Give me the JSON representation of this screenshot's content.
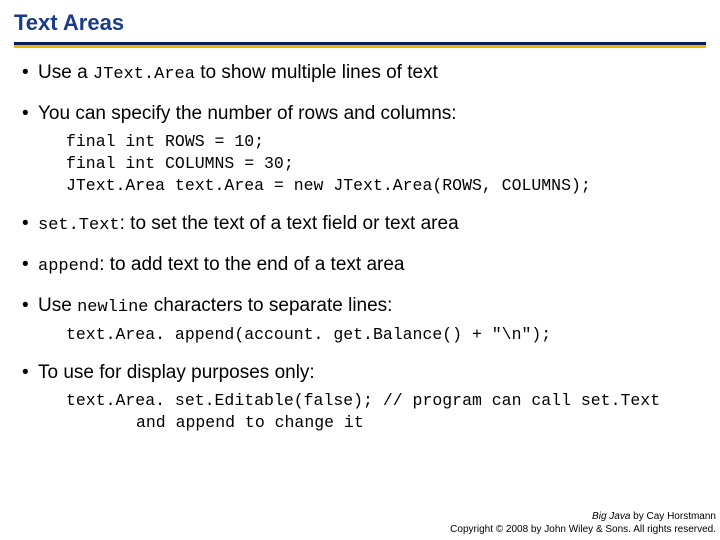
{
  "slide": {
    "title": "Text Areas",
    "bullets": {
      "b1": {
        "pre": "Use a ",
        "code": "JText.Area",
        "post": " to show multiple lines of text"
      },
      "b2": {
        "text": "You can specify the number of rows and columns:",
        "code": "final int ROWS = 10;\nfinal int COLUMNS = 30;\nJText.Area text.Area = new JText.Area(ROWS, COLUMNS);"
      },
      "b3": {
        "code": "set.Text",
        "post": ": to set the text of a text field or text area"
      },
      "b4": {
        "code": "append",
        "post": ": to add text to the end of a text area"
      },
      "b5": {
        "pre": "Use ",
        "code": "newline",
        "post": " characters to separate lines:",
        "codeblock": "text.Area. append(account. get.Balance() + \"\\n\");"
      },
      "b6": {
        "text": "To use for display purposes only:",
        "code_line1": "text.Area. set.Editable(false); // program can call set.Text",
        "code_line2": "and append to change it"
      }
    },
    "footer": {
      "line1a": "Big Java",
      "line1b": " by Cay Horstmann",
      "line2": "Copyright © 2008 by John Wiley & Sons. All rights reserved."
    }
  }
}
